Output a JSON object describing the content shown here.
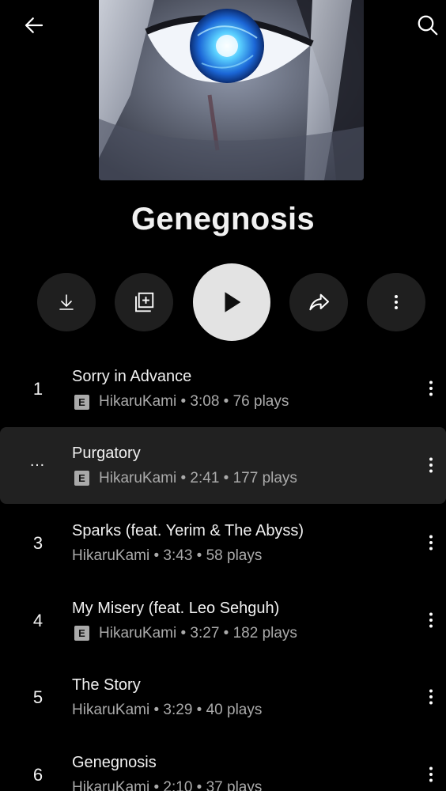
{
  "album": {
    "title": "Genegnosis"
  },
  "icons": {
    "back": "arrow-left-icon",
    "search": "search-icon",
    "download": "download-icon",
    "save": "library-add-icon",
    "play": "play-icon",
    "share": "share-icon",
    "more": "more-vertical-icon"
  },
  "tracks": [
    {
      "number": "1",
      "title": "Sorry in Advance",
      "explicit": true,
      "meta": "HikaruKami • 3:08 • 76 plays",
      "active": false
    },
    {
      "number": "…",
      "title": "Purgatory",
      "explicit": true,
      "meta": "HikaruKami • 2:41 • 177 plays",
      "active": true
    },
    {
      "number": "3",
      "title": "Sparks (feat. Yerim & The Abyss)",
      "explicit": false,
      "meta": "HikaruKami • 3:43 • 58 plays",
      "active": false
    },
    {
      "number": "4",
      "title": "My Misery (feat. Leo Sehguh)",
      "explicit": true,
      "meta": "HikaruKami • 3:27 • 182 plays",
      "active": false
    },
    {
      "number": "5",
      "title": "The Story",
      "explicit": false,
      "meta": "HikaruKami • 3:29 • 40 plays",
      "active": false
    },
    {
      "number": "6",
      "title": "Genegnosis",
      "explicit": false,
      "meta": "HikaruKami • 2:10 • 37 plays",
      "active": false
    }
  ],
  "explicit_badge": "E",
  "colors": {
    "background": "#000000",
    "active_row": "#212121",
    "play_button": "#e3e3e3",
    "secondary_text": "#aaaaaa"
  }
}
